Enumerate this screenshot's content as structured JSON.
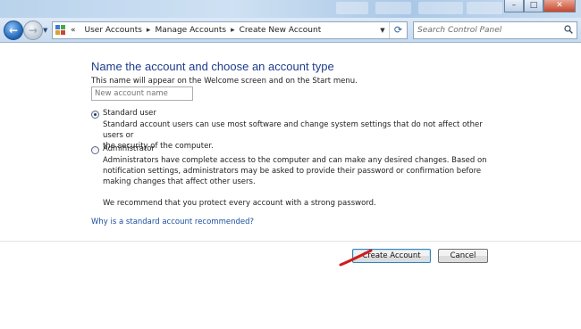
{
  "address_bar": {
    "overflow": "«",
    "breadcrumbs": [
      "User Accounts",
      "Manage Accounts",
      "Create New Account"
    ]
  },
  "search": {
    "placeholder": "Search Control Panel"
  },
  "page": {
    "title": "Name the account and choose an account type",
    "subtitle": "This name will appear on the Welcome screen and on the Start menu.",
    "name_placeholder": "New account name"
  },
  "options": [
    {
      "label": "Standard user",
      "checked": true,
      "lines": [
        "Standard account users can use most software and change system settings that do not affect other users or",
        "the security of the computer."
      ]
    },
    {
      "label": "Administrator",
      "checked": false,
      "lines": [
        "Administrators have complete access to the computer and can make any desired changes. Based on",
        "notification settings, administrators may be asked to provide their password or confirmation before",
        "making changes that affect other users."
      ]
    }
  ],
  "recommendation": "We recommend that you protect every account with a strong password.",
  "help_link": "Why is a standard account recommended?",
  "buttons": {
    "create": "Create Account",
    "cancel": "Cancel"
  },
  "colors": {
    "title": "#1e3d8c",
    "link": "#1a4fa0",
    "annotation": "#d01c1c"
  }
}
